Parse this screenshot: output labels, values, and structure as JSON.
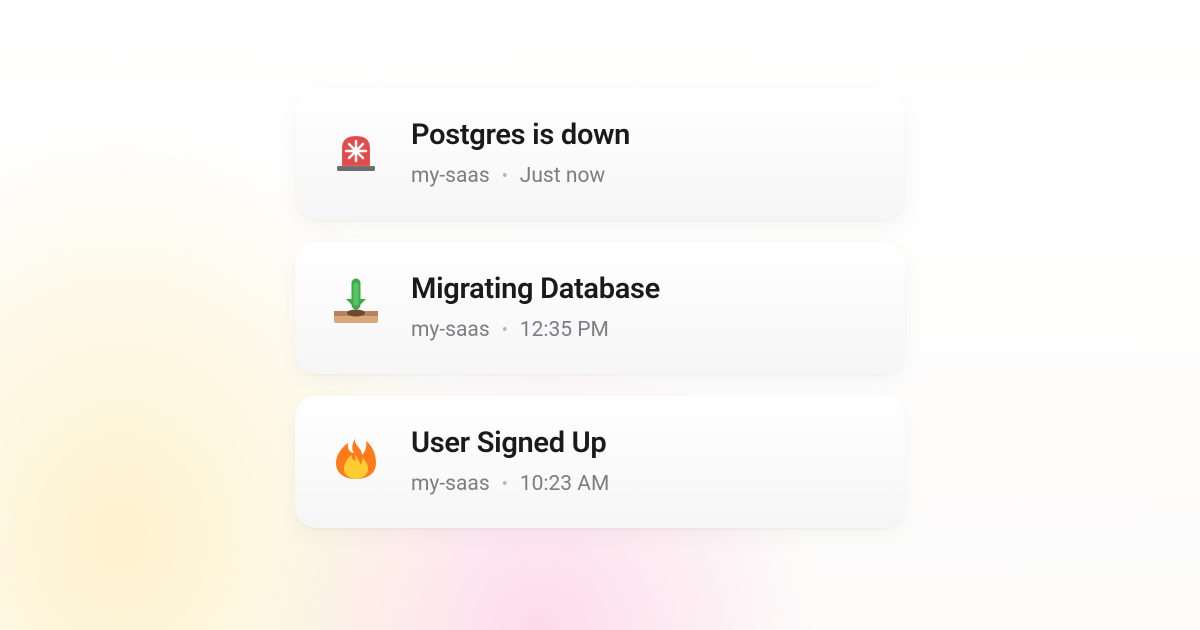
{
  "notifications": [
    {
      "icon": "siren",
      "title": "Postgres is down",
      "project": "my-saas",
      "time": "Just now"
    },
    {
      "icon": "inbox-download",
      "title": "Migrating Database",
      "project": "my-saas",
      "time": "12:35 PM"
    },
    {
      "icon": "fire",
      "title": "User Signed Up",
      "project": "my-saas",
      "time": "10:23 AM"
    }
  ]
}
